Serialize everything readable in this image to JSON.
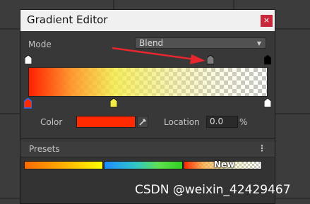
{
  "window": {
    "title": "Gradient Editor",
    "close_label": "×"
  },
  "mode": {
    "label": "Mode",
    "selected": "Blend",
    "arrow_icon": "chevron-down-icon"
  },
  "gradient": {
    "alpha_keys": [
      {
        "location": 0,
        "alpha": 1.0
      },
      {
        "location": 0.76,
        "alpha": 0.5
      },
      {
        "location": 1.0,
        "alpha": 0.0
      }
    ],
    "color_keys": [
      {
        "location": 0,
        "color": "#ff2a00",
        "selected": true
      },
      {
        "location": 0.36,
        "color": "#f5eb46"
      },
      {
        "location": 1.0,
        "color": "#ffffff"
      }
    ]
  },
  "color_row": {
    "color_label": "Color",
    "color_value": "#ff2a00",
    "eyedropper_icon": "eyedropper-icon",
    "location_label": "Location",
    "location_value": "0.0",
    "percent_label": "%"
  },
  "presets": {
    "label": "Presets",
    "menu_icon": "kebab-menu-icon",
    "menu_glyph": "⋮",
    "new_label": "New"
  },
  "annotation": {
    "arrow_color": "#e8262e"
  },
  "watermark": {
    "text": "CSDN @weixin_42429467"
  }
}
